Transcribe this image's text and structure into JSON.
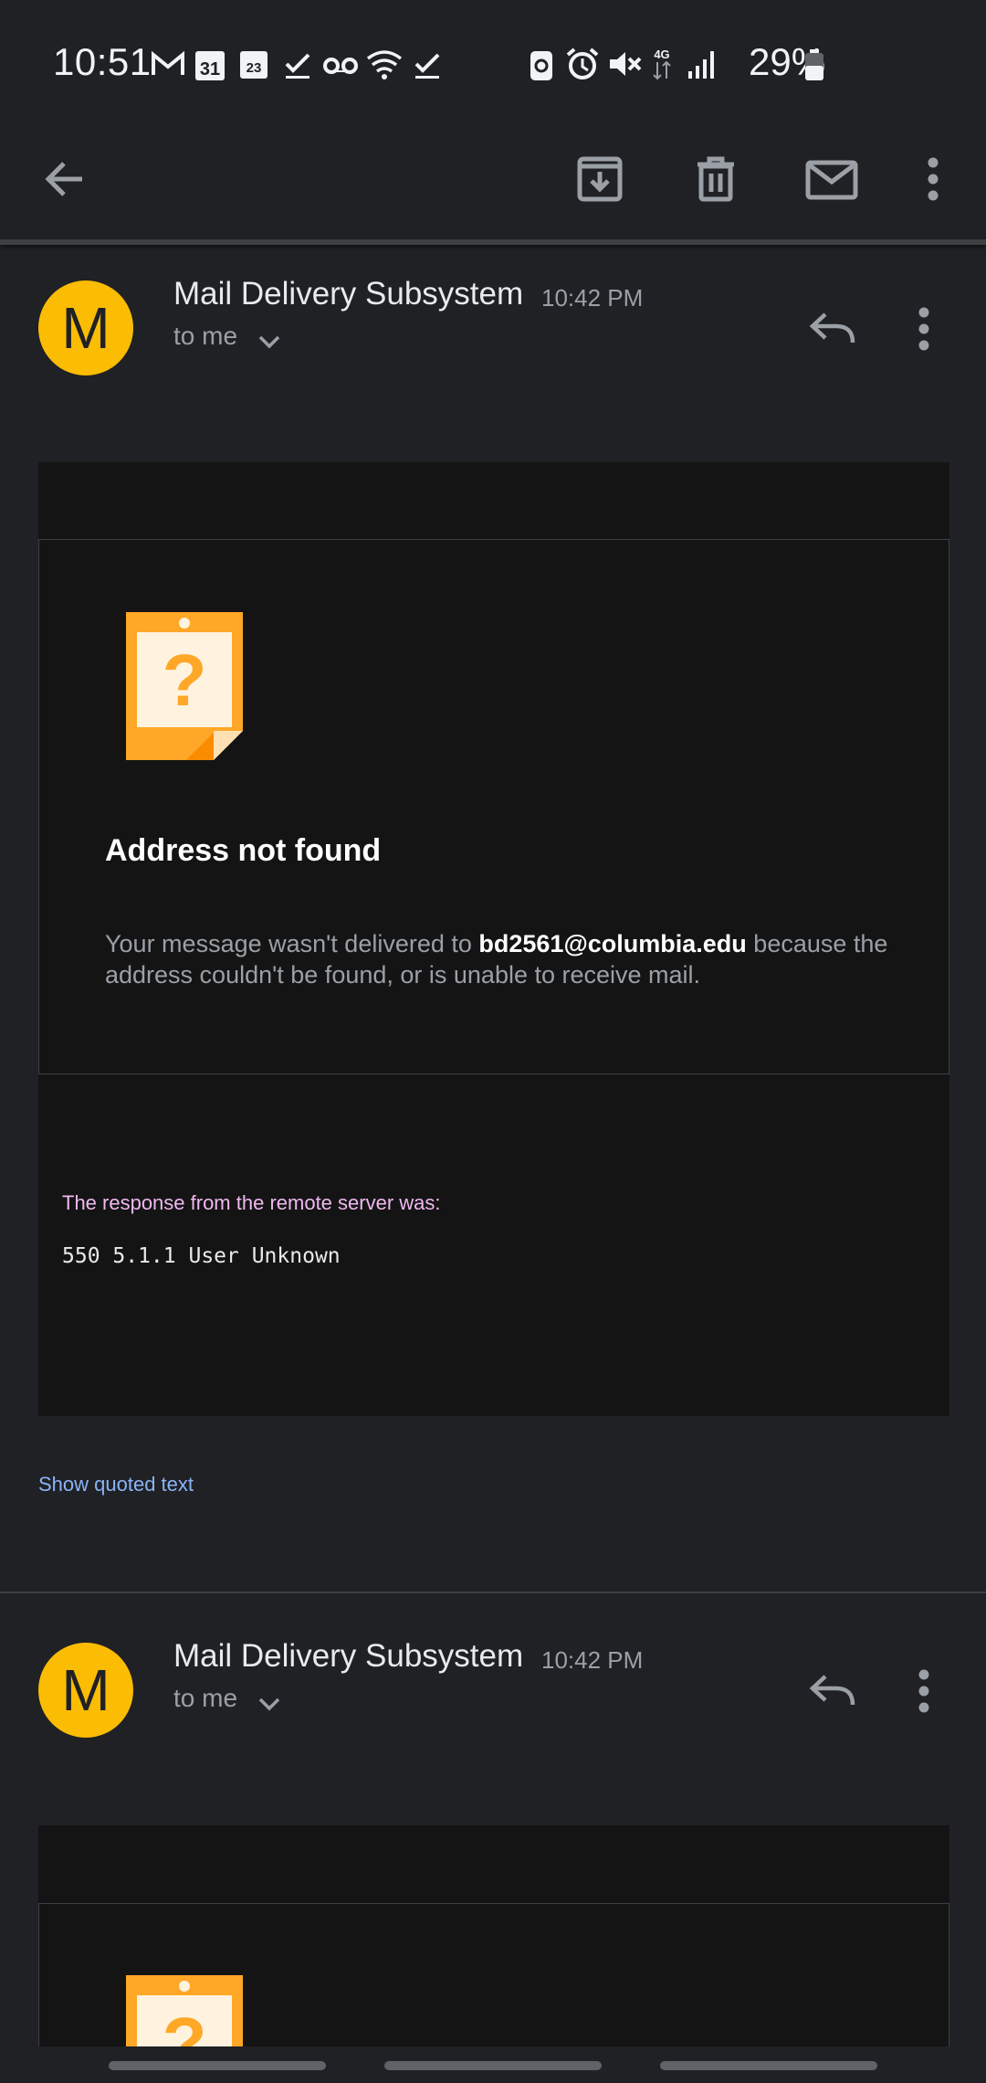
{
  "status_bar": {
    "time": "10:51",
    "battery": "29%",
    "icons": [
      "gmail-icon",
      "calendar-31-icon",
      "calendar-23-icon",
      "check-icon",
      "voicemail-icon",
      "wifi-icon",
      "check-icon",
      "recycle-icon",
      "alarm-icon",
      "mute-icon",
      "4g-icon",
      "signal-icon",
      "battery-icon"
    ]
  },
  "toolbar": {
    "icons": [
      "back-arrow-icon",
      "archive-icon",
      "delete-icon",
      "mark-unread-icon",
      "more-vert-icon"
    ]
  },
  "messages": [
    {
      "avatar_letter": "M",
      "sender": "Mail Delivery Subsystem",
      "time": "10:42 PM",
      "recipient": "to me",
      "heading": "Address not found",
      "desc_before": "Your message wasn't delivered to ",
      "desc_email": "bd2561@columbia.edu",
      "desc_after": " because the address couldn't be found, or is unable to receive mail.",
      "response_label": "The response from the remote server was:",
      "response_code": "550 5.1.1 User Unknown",
      "show_quoted": "Show quoted text"
    },
    {
      "avatar_letter": "M",
      "sender": "Mail Delivery Subsystem",
      "time": "10:42 PM",
      "recipient": "to me"
    }
  ],
  "colors": {
    "background": "#202124",
    "avatar": "#fbbc04",
    "link": "#8ab4f8",
    "response_label": "#f0b8f0",
    "warning_icon": "#ffa726"
  }
}
